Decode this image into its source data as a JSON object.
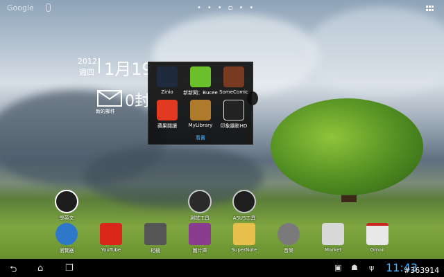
{
  "topbar": {
    "search_label": "Google"
  },
  "clock_widget": {
    "year": "2012",
    "weekday": "週四",
    "date": "1月19",
    "mail_count": "0封",
    "mail_label": "新的郵件"
  },
  "folder": {
    "name": "看書",
    "apps": [
      {
        "label": "Zinio",
        "color": "#1f2b3d"
      },
      {
        "label": "新新聞：Bucee",
        "color": "#6bbf2a"
      },
      {
        "label": "SomeComic",
        "color": "#7a3b22"
      },
      {
        "label": "蘋果閱讀",
        "color": "#e23a20"
      },
      {
        "label": "MyLibrary",
        "color": "#b07a2c"
      },
      {
        "label": "印象攝影HD",
        "color": "#222222"
      }
    ]
  },
  "desktop_shortcuts": [
    {
      "label": "學英文",
      "color": "#1d1d1d"
    },
    {
      "label": "測試工具",
      "color": "#2a2a2a"
    },
    {
      "label": "ASUS工具",
      "color": "#1e1e1e"
    }
  ],
  "dock": [
    {
      "label": "瀏覽器",
      "color": "#2d78c8"
    },
    {
      "label": "YouTube",
      "color": "#d9271c"
    },
    {
      "label": "相機",
      "color": "#555555"
    },
    {
      "label": "圖片庫",
      "color": "#8a3c8e"
    },
    {
      "label": "SuperNote",
      "color": "#e6c04a"
    },
    {
      "label": "音樂",
      "color": "#7a7a7a"
    },
    {
      "label": "Market",
      "color": "#d8d8d8"
    },
    {
      "label": "Gmail",
      "color": "#e8e8e8"
    }
  ],
  "navbar": {
    "back_glyph": "⮌",
    "home_glyph": "⌂",
    "recent_glyph": "❐",
    "clock": "11:43"
  },
  "watermark": "#363914"
}
